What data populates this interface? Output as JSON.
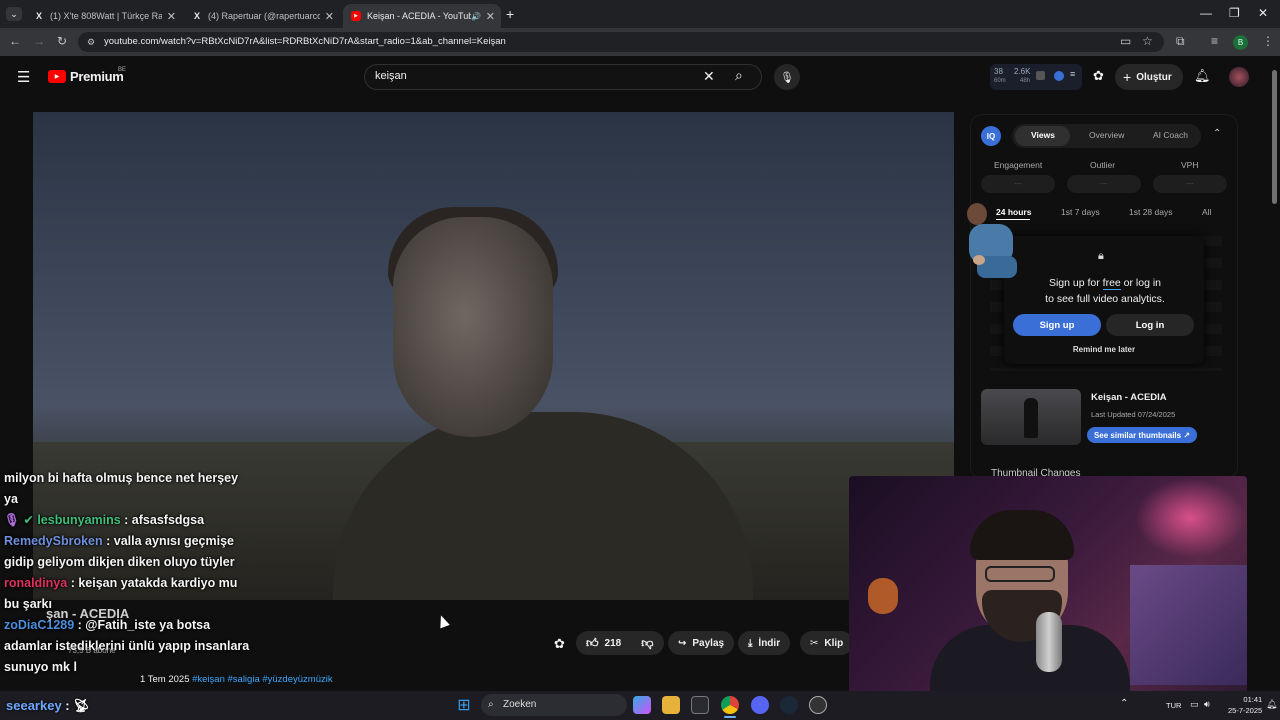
{
  "browser": {
    "tabs": [
      {
        "label": "(1) X'te 808Watt | Türkçe Rap: \"..."
      },
      {
        "label": "(4) Rapertuar (@rapertuarcom) / X"
      },
      {
        "label": "Keişan - ACEDIA - YouTube"
      }
    ],
    "url": "youtube.com/watch?v=RBtXcNiD7rA&list=RDRBtXcNiD7rA&start_radio=1&ab_channel=Keişan",
    "profile_initial": "B"
  },
  "youtube": {
    "logo_text": "Premium",
    "region": "BE",
    "search_value": "keişan",
    "stats": {
      "views_short": "38",
      "views_unit": "60m",
      "hours_short": "2.6K",
      "hours_unit": "48h"
    },
    "create_label": "Oluştur"
  },
  "chat": [
    {
      "user": "",
      "user_color": "#ffffff",
      "text": "milyon bi hafta olmuş bence net herşey ya"
    },
    {
      "user": "lesbunyamins",
      "user_color": "#3fbf7a",
      "text": " : afsasfsdgsa"
    },
    {
      "user": "RemedySbroken",
      "user_color": "#6f8fdc",
      "text": " : valla aynısı geçmişe gidip geliyom dikjen diken oluyo tüyler"
    },
    {
      "user": "ronaldinya",
      "user_color": "#e0305f",
      "text": " : keişan yatakda kardiyo mu bu şarkı"
    },
    {
      "user": "zoDiaC1289",
      "user_color": "#4a8fe0",
      "text": " : @Fatih_iste ya botsa adamlar istediklerini ünlü yapıp insanlara sunuyo mk l"
    }
  ],
  "bottom_chat_user": "seearkey",
  "video": {
    "title_fragment": "şan - ACEDIA",
    "subscribers": "73,5 B abone",
    "date": "1 Tem 2025",
    "tags": "#keişan #saligia #yüzdeyüzmüzik",
    "likes": "218",
    "share_label": "Paylaş",
    "download_label": "İndir",
    "clip_label": "Klip"
  },
  "analytics": {
    "logo": "IQ",
    "tabs": [
      "Views",
      "Overview",
      "AI Coach"
    ],
    "metrics": [
      "Engagement",
      "Outlier",
      "VPH"
    ],
    "metric_placeholder": "---",
    "ranges": [
      "24 hours",
      "1st 7 days",
      "1st 28 days",
      "All"
    ],
    "signup_msg_1": "Sign up for ",
    "signup_free": "free",
    "signup_msg_2": " or log in",
    "signup_msg_3": "to see full video analytics.",
    "signup_label": "Sign up",
    "login_label": "Log in",
    "remind_label": "Remind me later",
    "thumb_title": "Keişan - ACEDIA",
    "thumb_updated": "Last Updated 07/24/2025",
    "similar_label": "See similar thumbnails ↗",
    "thumb_changes": "Thumbnail Changes"
  },
  "taskbar": {
    "search_label": "Zoeken",
    "lang": "TUR",
    "time": "01:41",
    "date": "25-7-2025"
  },
  "colors": {
    "accent": "#3b6fd8",
    "yt_red": "#ff0000"
  }
}
